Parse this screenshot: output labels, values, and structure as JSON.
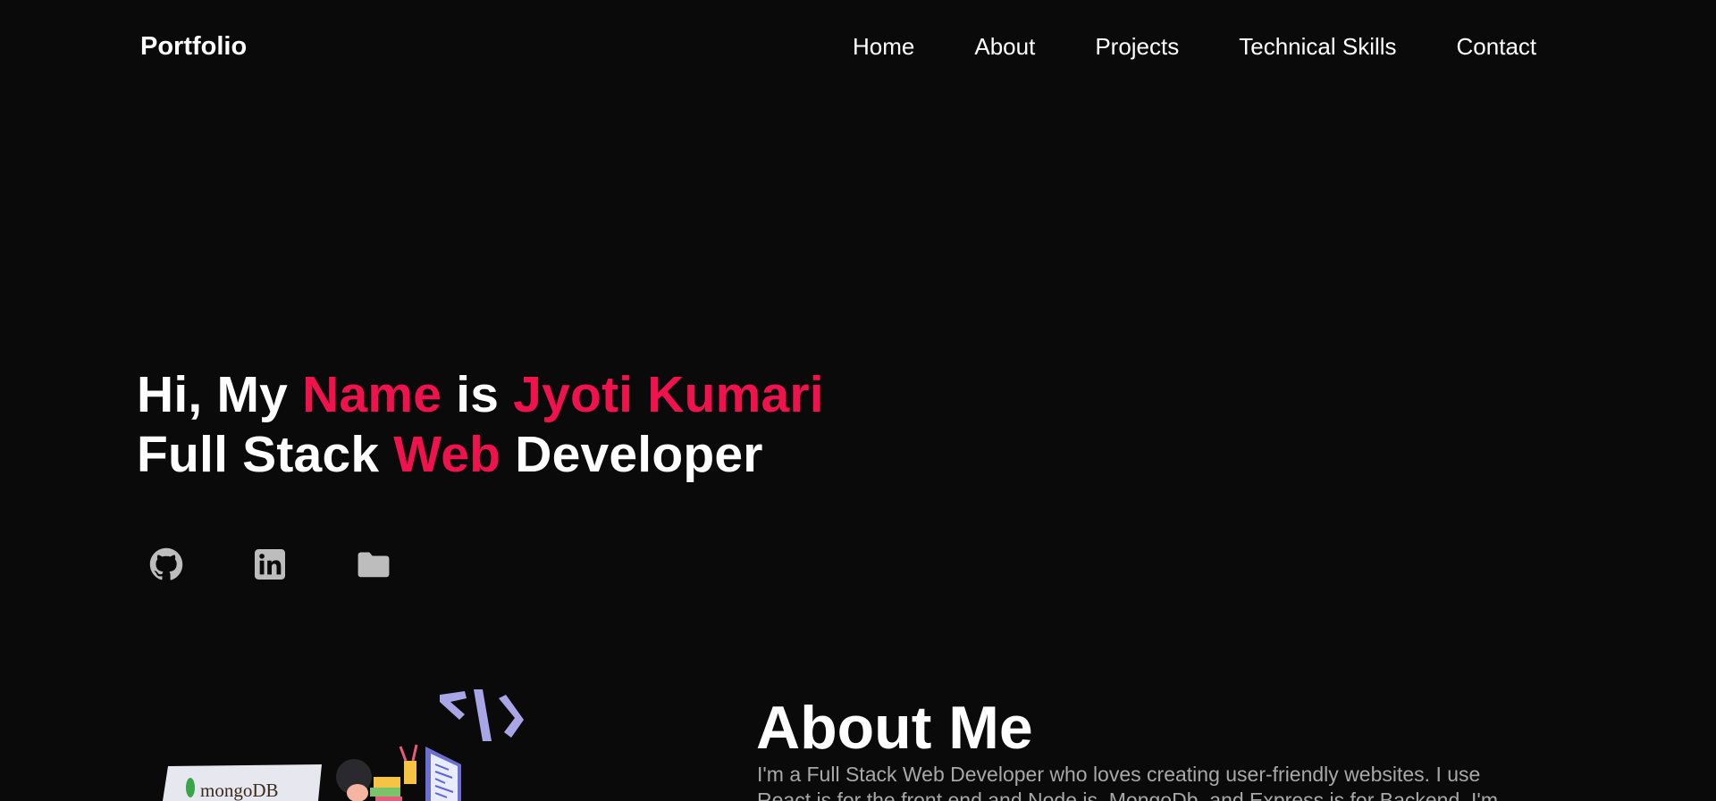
{
  "brand": "Portfolio",
  "nav": [
    {
      "label": "Home"
    },
    {
      "label": "About"
    },
    {
      "label": "Projects"
    },
    {
      "label": "Technical Skills"
    },
    {
      "label": "Contact"
    }
  ],
  "hero": {
    "line1": {
      "part1": "Hi, My ",
      "accent1": "Name",
      "part2": " is ",
      "accent2": "Jyoti Kumari"
    },
    "line2": {
      "part1": "Full Stack ",
      "accent1": "Web",
      "part2": " Developer"
    }
  },
  "socials": [
    {
      "icon": "github-icon"
    },
    {
      "icon": "linkedin-icon"
    },
    {
      "icon": "folder-icon"
    }
  ],
  "about": {
    "title": "About Me",
    "text": "I'm a Full Stack Web Developer who loves creating user-friendly websites. I use React.js for the front end and Node.js, MongoDb, and Express.js for Backend. I'm",
    "illustration_label": "mongoDB"
  },
  "colors": {
    "background": "#0a0a0b",
    "accent": "#f0124d",
    "icon": "#bdbdbd",
    "muted_text": "#a8a8a8"
  }
}
